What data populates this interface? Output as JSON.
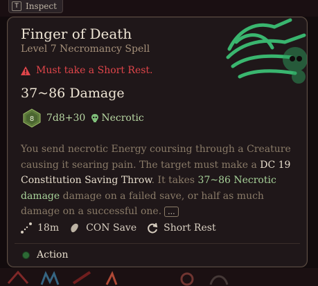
{
  "inspect": {
    "key": "T",
    "label": "Inspect"
  },
  "spell": {
    "name": "Finger of Death",
    "level_school": "Level 7 Necromancy Spell",
    "warning": "Must take a Short Rest.",
    "damage": "37~86 Damage",
    "die_value": "8",
    "dice": "7d8+30",
    "damage_type": "Necrotic"
  },
  "description": {
    "part1": "You send necrotic Energy coursing through a Creature causing it searing pain. The target must make a ",
    "dc": "DC 19 Constitution Saving Throw",
    "part2": ". It takes ",
    "dmg": "37~86 Necrotic damage",
    "part3": " damage on a failed save, or half as much damage on a successful one.",
    "more": "..."
  },
  "stats": {
    "range": "18m",
    "save": "CON Save",
    "rest": "Short Rest"
  },
  "action": {
    "label": "Action"
  },
  "colors": {
    "warning": "#e0454a",
    "accent_green": "#a8d39a",
    "card_border": "#5f5044",
    "action_dot": "#2d6a35"
  }
}
